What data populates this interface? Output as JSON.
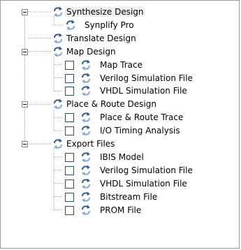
{
  "tree": {
    "items": [
      {
        "id": "synth",
        "label": "Synthesize Design",
        "level": 0,
        "expander": true,
        "checkbox": false,
        "selected": true
      },
      {
        "id": "synplify",
        "label": "Synplify Pro",
        "level": 1,
        "expander": false,
        "checkbox": false
      },
      {
        "id": "translate",
        "label": "Translate Design",
        "level": 0,
        "expander": false,
        "checkbox": false
      },
      {
        "id": "map",
        "label": "Map Design",
        "level": 0,
        "expander": true,
        "checkbox": false
      },
      {
        "id": "map-trace",
        "label": "Map Trace",
        "level": 1,
        "expander": false,
        "checkbox": true
      },
      {
        "id": "map-verilog",
        "label": "Verilog Simulation File",
        "level": 1,
        "expander": false,
        "checkbox": true
      },
      {
        "id": "map-vhdl",
        "label": "VHDL Simulation File",
        "level": 1,
        "expander": false,
        "checkbox": true
      },
      {
        "id": "par",
        "label": "Place & Route Design",
        "level": 0,
        "expander": true,
        "checkbox": false
      },
      {
        "id": "par-trace",
        "label": "Place & Route Trace",
        "level": 1,
        "expander": false,
        "checkbox": true
      },
      {
        "id": "io-timing",
        "label": "I/O Timing Analysis",
        "level": 1,
        "expander": false,
        "checkbox": true
      },
      {
        "id": "export",
        "label": "Export Files",
        "level": 0,
        "expander": true,
        "checkbox": false
      },
      {
        "id": "ibis",
        "label": "IBIS Model",
        "level": 1,
        "expander": false,
        "checkbox": true
      },
      {
        "id": "exp-verilog",
        "label": "Verilog Simulation File",
        "level": 1,
        "expander": false,
        "checkbox": true
      },
      {
        "id": "exp-vhdl",
        "label": "VHDL Simulation File",
        "level": 1,
        "expander": false,
        "checkbox": true
      },
      {
        "id": "bitstream",
        "label": "Bitstream File",
        "level": 1,
        "expander": false,
        "checkbox": true
      },
      {
        "id": "prom",
        "label": "PROM File",
        "level": 1,
        "expander": false,
        "checkbox": true
      }
    ]
  },
  "icons": {
    "process": "process-arrows-icon",
    "expander": "collapse-minus-icon",
    "checkbox": "checkbox-icon"
  },
  "colors": {
    "icon_blue": "#2f5d9c",
    "icon_light": "#7fa8dc",
    "tree_line": "#a0a0a0",
    "checkbox_border": "#1c5180",
    "selection": "#f0f0f0"
  }
}
